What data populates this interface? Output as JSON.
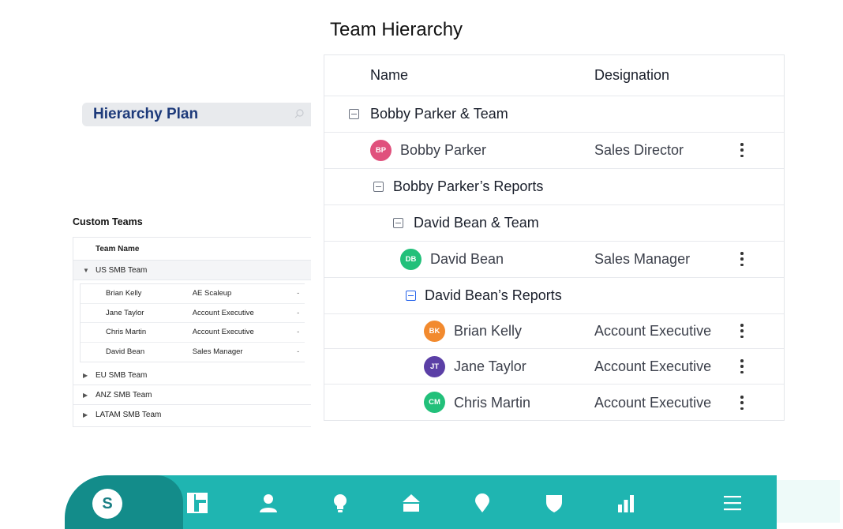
{
  "page": {
    "title": "Team Hierarchy"
  },
  "hierarchy_plan": {
    "label": "Hierarchy Plan",
    "search_icon": "search-icon"
  },
  "custom_teams": {
    "title": "Custom Teams",
    "column": "Team Name",
    "teams": [
      {
        "name": "US SMB Team",
        "expanded": true
      },
      {
        "name": "EU SMB Team",
        "expanded": false
      },
      {
        "name": "ANZ SMB Team",
        "expanded": false
      },
      {
        "name": "LATAM SMB Team",
        "expanded": false
      }
    ],
    "members": [
      {
        "name": "Brian Kelly",
        "designation": "AE Scaleup",
        "extra": "-"
      },
      {
        "name": "Jane Taylor",
        "designation": "Account Executive",
        "extra": "-"
      },
      {
        "name": "Chris Martin",
        "designation": "Account Executive",
        "extra": "-"
      },
      {
        "name": "David Bean",
        "designation": "Sales Manager",
        "extra": "-"
      }
    ]
  },
  "table": {
    "columns": {
      "name": "Name",
      "designation": "Designation"
    },
    "rows": [
      {
        "kind": "group",
        "label": "Bobby Parker & Team"
      },
      {
        "kind": "person",
        "initials": "BP",
        "name": "Bobby Parker",
        "designation": "Sales Director",
        "color": "#e0517d"
      },
      {
        "kind": "group",
        "label": "Bobby Parker’s Reports"
      },
      {
        "kind": "group",
        "label": "David Bean & Team"
      },
      {
        "kind": "person",
        "initials": "DB",
        "name": "David Bean",
        "designation": "Sales Manager",
        "color": "#22c07a"
      },
      {
        "kind": "group",
        "label": "David Bean’s Reports"
      },
      {
        "kind": "person",
        "initials": "BK",
        "name": "Brian Kelly",
        "designation": "Account Executive",
        "color": "#f28a2e"
      },
      {
        "kind": "person",
        "initials": "JT",
        "name": "Jane Taylor",
        "designation": "Account Executive",
        "color": "#5b3fa6"
      },
      {
        "kind": "person",
        "initials": "CM",
        "name": "Chris Martin",
        "designation": "Account Executive",
        "color": "#22c07a"
      }
    ]
  },
  "nav": {
    "logo": "S",
    "accent": "#1fb5b1",
    "items": [
      "dashboard-icon",
      "user-icon",
      "bulb-icon",
      "home-icon",
      "location-icon",
      "shield-icon",
      "bar-chart-icon",
      "menu-icon"
    ]
  }
}
